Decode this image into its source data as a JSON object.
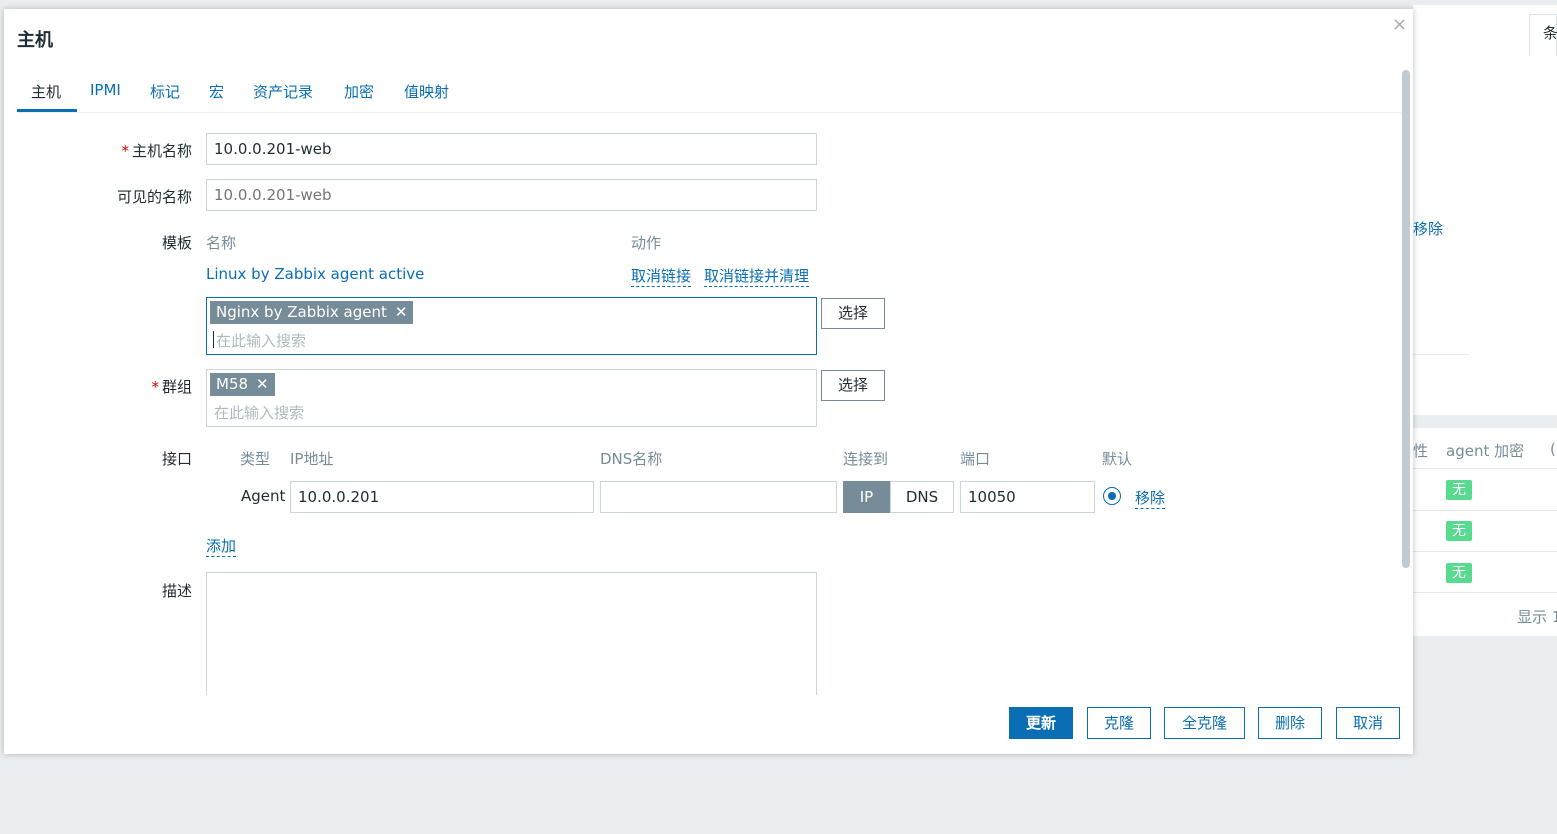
{
  "background": {
    "tab_char": "条",
    "remove_link": "移除",
    "col_partial": "性",
    "col_agent_encryption": "agent 加密",
    "col_partial2": "(",
    "badges": [
      "无",
      "无",
      "无"
    ],
    "display_text": "显示 1"
  },
  "dialog": {
    "title": "主机",
    "close_symbol": "×",
    "tabs": [
      "主机",
      "IPMI",
      "标记",
      "宏",
      "资产记录",
      "加密",
      "值映射"
    ],
    "active_tab": "主机"
  },
  "form": {
    "host_name": {
      "label": "主机名称",
      "value": "10.0.0.201-web"
    },
    "visible_name": {
      "label": "可见的名称",
      "placeholder": "10.0.0.201-web"
    },
    "templates": {
      "label": "模板",
      "col_name": "名称",
      "col_action": "动作",
      "linked": [
        {
          "name": "Linux by Zabbix agent active",
          "unlink": "取消链接",
          "unlink_clear": "取消链接并清理"
        }
      ],
      "new_chip": "Nginx by Zabbix agent",
      "search_placeholder": "在此输入搜索",
      "select_button": "选择"
    },
    "groups": {
      "label": "群组",
      "chip": "M58",
      "search_placeholder": "在此输入搜索",
      "select_button": "选择"
    },
    "interfaces": {
      "label": "接口",
      "headers": {
        "type": "类型",
        "ip": "IP地址",
        "dns": "DNS名称",
        "connect_to": "连接到",
        "port": "端口",
        "default": "默认"
      },
      "rows": [
        {
          "type": "Agent",
          "ip": "10.0.0.201",
          "dns": "",
          "connect_ip": "IP",
          "connect_dns": "DNS",
          "port": "10050",
          "remove": "移除"
        }
      ],
      "add_link": "添加"
    },
    "description": {
      "label": "描述",
      "value": ""
    }
  },
  "footer": {
    "update": "更新",
    "clone": "克隆",
    "full_clone": "全克隆",
    "delete": "删除",
    "cancel": "取消"
  },
  "colors": {
    "accent": "#0a6eb4",
    "chip": "#768d99",
    "badge": "#59db8f"
  }
}
